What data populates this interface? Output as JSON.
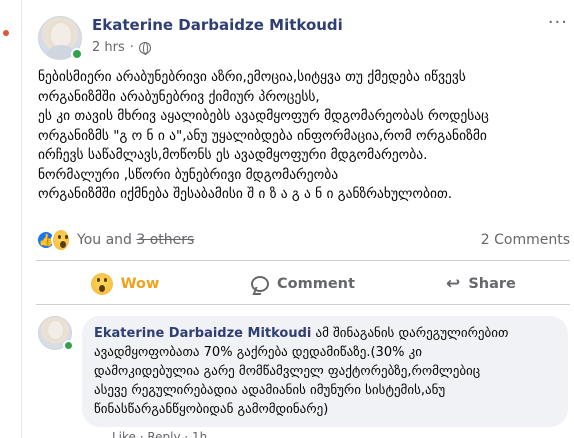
{
  "post": {
    "author": "Ekaterine Darbaidze Mitkoudi",
    "time": "2 hrs",
    "privacy_separator": "·",
    "more_label": "···",
    "body_lines": [
      "ნებისმიერი არაბუნებრივი აზრი,ემოცია,სიტყვა თუ ქმედება იწვევს",
      "ორგანიზმში არაბუნებრივ ქიმიურ პროცესს,",
      "ეს კი თავის მხრივ აყალიბებს ავადმყოფურ მდგომარეობას როდესაც",
      "ორგანიზმს \"გ ო ნ ი ა\",ანუ უყალიბდება ინფორმაცია,რომ ორგანიზმი",
      "ირჩევს საწამლავს,მოწონს ეს ავადმყოფური მდგომარეობა.",
      "ნორმალური ,სწორი ბუნებრივი მდგომარეობა",
      "ორგანიზმში იქმნება შესაბამისი შ ი ზ ა გ ა ნ ი განზრახულობით."
    ],
    "reactions_label_prefix": "You and ",
    "reactions_label_strike": "3 others",
    "comment_count": "2 Comments",
    "actions": {
      "wow": "Wow",
      "comment": "Comment",
      "share": "Share"
    }
  },
  "comment": {
    "author": "Ekaterine Darbaidze Mitkoudi",
    "first_line_text": " ამ შინაგანის დარეგულირებით",
    "lines": [
      "ავადმყოფობათა 70% გაქრება დედამიწაზე.(30% კი",
      "დამოკიდებულია გარე მომწამვლელ ფაქტორებზე,რომლებიც",
      "ასევე რეგულირებადია ადამიანის იმუნური სისტემის,ანუ",
      "წინასწარგანწყობიდან გამომდინარე)"
    ],
    "actions_text": "Like · Reply · 1h"
  },
  "colors": {
    "author_name": "#2f3e73",
    "wow_accent": "#f0a21e",
    "like_blue": "#1877f2",
    "online_green": "#31a24c"
  },
  "icons": [
    "globe-icon",
    "like-reaction-icon",
    "wow-reaction-icon",
    "comment-icon",
    "share-icon",
    "more-options-icon"
  ]
}
